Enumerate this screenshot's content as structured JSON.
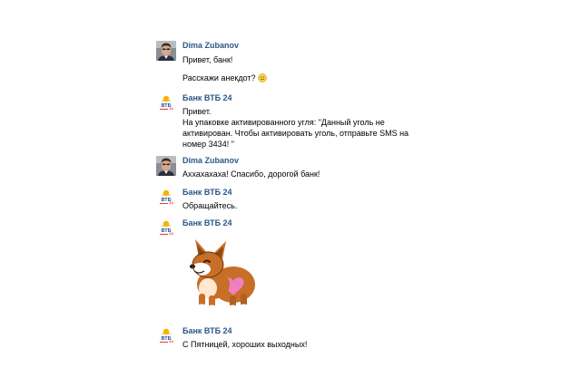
{
  "colors": {
    "sender_link": "#2b5788",
    "bank_logo_blue": "#1f4fa0",
    "bank_logo_red": "#e23a2f",
    "bank_logo_yellow": "#f5b400",
    "corgi_body": "#c76f27",
    "corgi_heart": "#f27ec2"
  },
  "chat": {
    "messages": [
      {
        "sender": "Dima Zubanov",
        "avatar_icon": "user-photo-avatar",
        "lines": [
          "Привет, банк!",
          "Расскажи анекдот?"
        ],
        "emoji": "slightly-smiling-face-icon"
      },
      {
        "sender": "Банк ВТБ 24",
        "avatar_icon": "vtb24-logo-avatar",
        "lines": [
          "Привет.",
          "На упаковке активированного угля: \"Данный уголь не",
          "активирован. Чтобы активировать уголь, отправьте SMS на",
          "номер 3434! \""
        ]
      },
      {
        "sender": "Dima Zubanov",
        "avatar_icon": "user-photo-avatar",
        "lines": [
          "Аххахахаха! Спасибо, дорогой банк!"
        ]
      },
      {
        "sender": "Банк ВТБ 24",
        "avatar_icon": "vtb24-logo-avatar",
        "lines": [
          "Обращайтесь."
        ]
      },
      {
        "sender": "Банк ВТБ 24",
        "avatar_icon": "vtb24-logo-avatar",
        "sticker": "corgi-heart-sticker"
      },
      {
        "sender": "Банк ВТБ 24",
        "avatar_icon": "vtb24-logo-avatar",
        "lines": [
          "С Пятницей, хороших выходных!"
        ]
      }
    ]
  }
}
